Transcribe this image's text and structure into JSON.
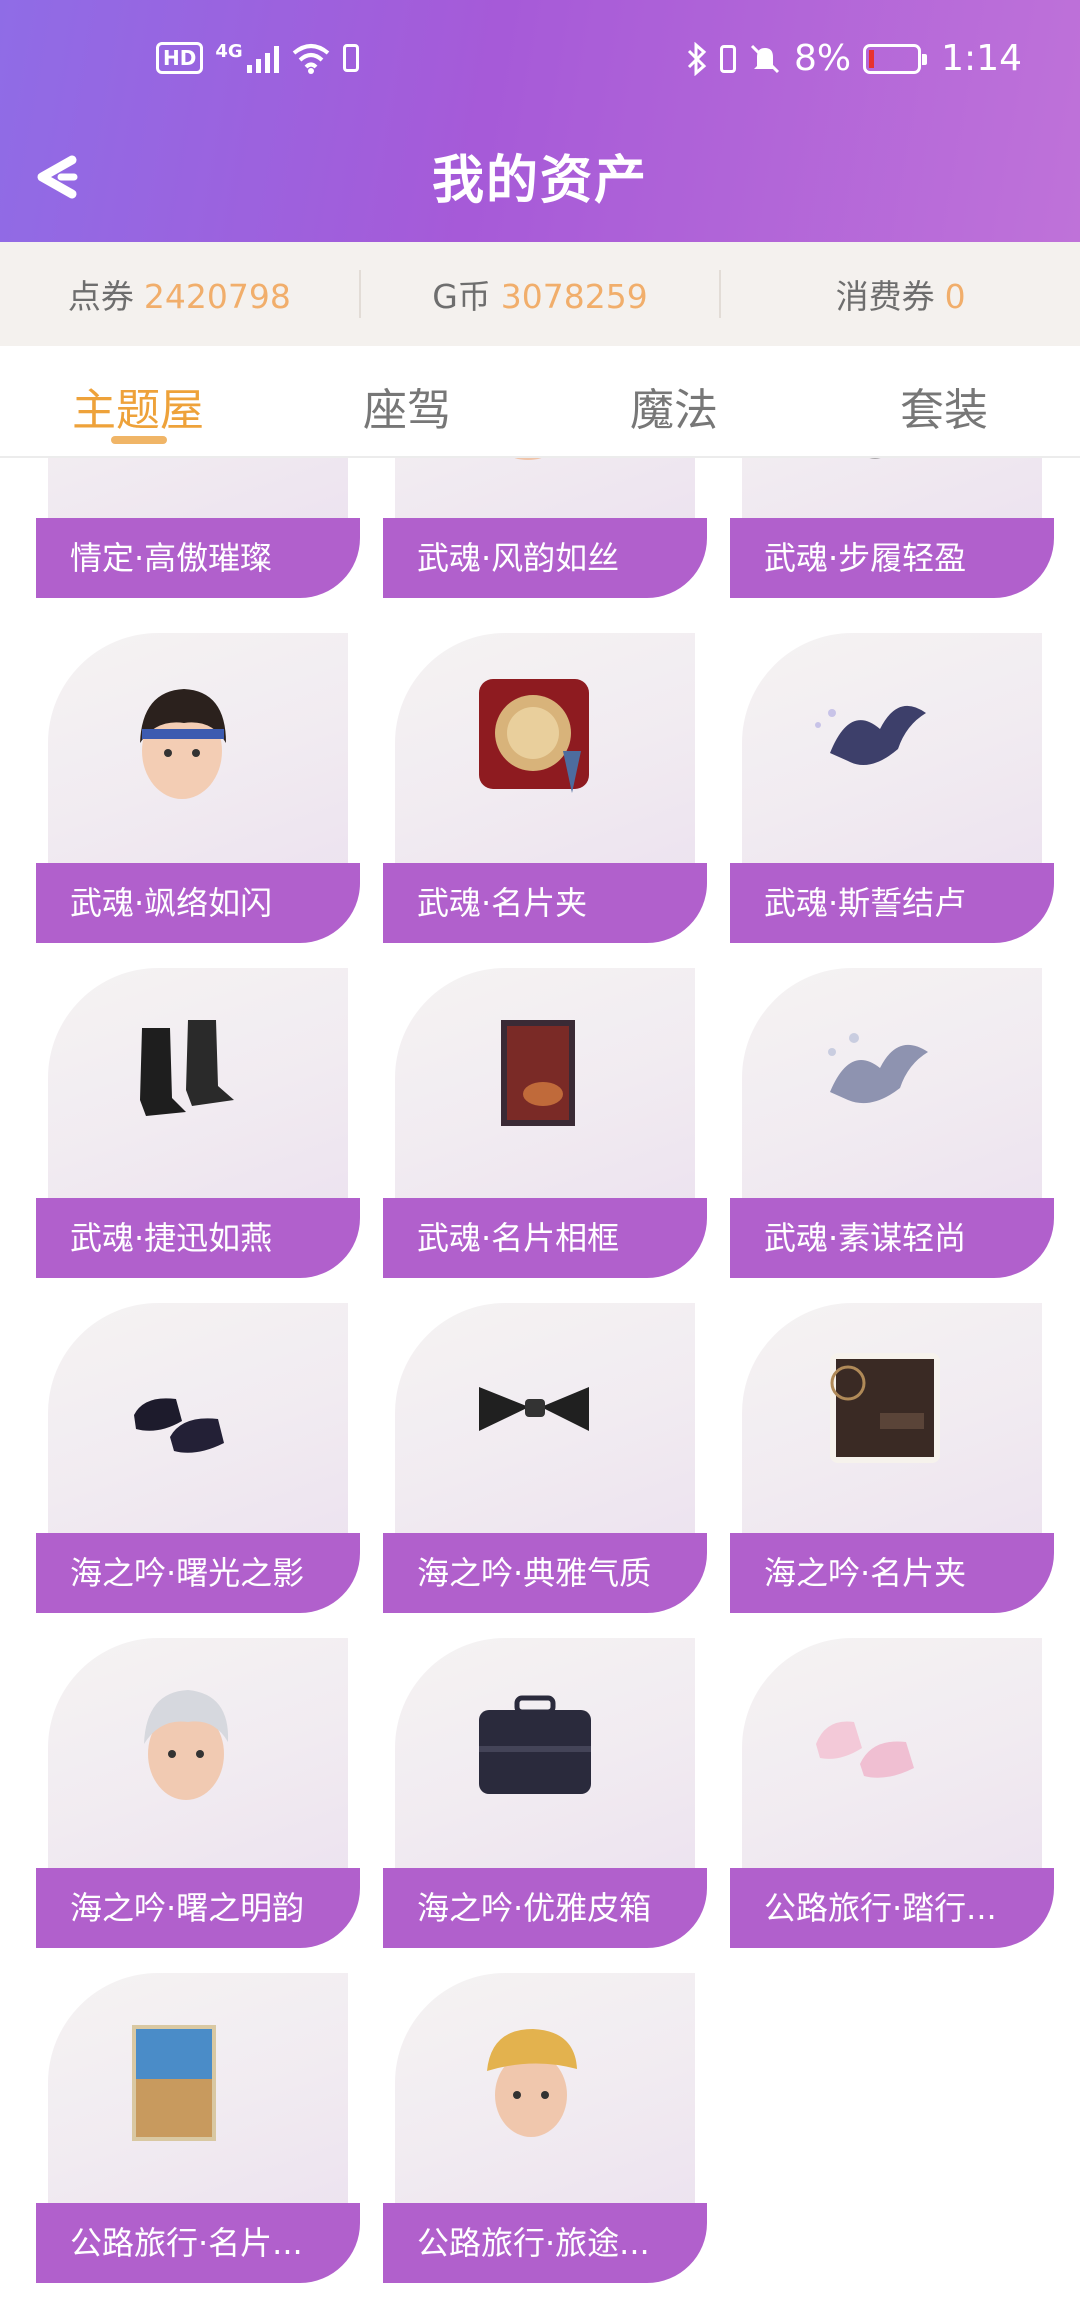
{
  "status_bar": {
    "hd": "HD",
    "network": "4G",
    "battery_pct": "8%",
    "time": "1:14",
    "icons": [
      "hd-icon",
      "signal-icon",
      "wifi-icon",
      "phone-battery-icon",
      "bluetooth-icon",
      "vibrate-icon",
      "mute-icon",
      "battery-icon"
    ]
  },
  "header": {
    "title": "我的资产",
    "back_icon": "back-arrow-icon"
  },
  "currency": {
    "points_label": "点券",
    "points_value": "2420798",
    "gcoin_label": "G币",
    "gcoin_value": "3078259",
    "voucher_label": "消费券",
    "voucher_value": "0",
    "value_color": "#f1ae6b"
  },
  "tabs": [
    {
      "label": "主题屋",
      "active": true
    },
    {
      "label": "座驾",
      "active": false
    },
    {
      "label": "魔法",
      "active": false
    },
    {
      "label": "套装",
      "active": false
    }
  ],
  "items": [
    {
      "name": "情定·高傲璀璨",
      "icon": "outfit-icon"
    },
    {
      "name": "武魂·风韵如丝",
      "icon": "face-icon"
    },
    {
      "name": "武魂·步履轻盈",
      "icon": "shoes-icon"
    },
    {
      "name": "武魂·飒络如闪",
      "icon": "hair-head-icon"
    },
    {
      "name": "武魂·名片夹",
      "icon": "card-holder-icon"
    },
    {
      "name": "武魂·斯誓结卢",
      "icon": "cloud-ribbon-icon"
    },
    {
      "name": "武魂·捷迅如燕",
      "icon": "boots-icon"
    },
    {
      "name": "武魂·名片相框",
      "icon": "photo-frame-icon"
    },
    {
      "name": "武魂·素谋轻尚",
      "icon": "cloud-ribbon-icon"
    },
    {
      "name": "海之吟·曙光之影",
      "icon": "loafers-icon"
    },
    {
      "name": "海之吟·典雅气质",
      "icon": "bow-tie-icon"
    },
    {
      "name": "海之吟·名片夹",
      "icon": "card-holder-icon"
    },
    {
      "name": "海之吟·曙之明韵",
      "icon": "silver-hair-head-icon"
    },
    {
      "name": "海之吟·优雅皮箱",
      "icon": "suitcase-icon"
    },
    {
      "name": "公路旅行·踏行...",
      "icon": "sneakers-icon"
    },
    {
      "name": "公路旅行·名片...",
      "icon": "postcard-icon"
    },
    {
      "name": "公路旅行·旅途...",
      "icon": "cap-head-icon"
    }
  ],
  "colors": {
    "header_start": "#8f6ce6",
    "header_end": "#bf72d9",
    "label_bg": "#b160cc",
    "active_tab": "#eea23a"
  }
}
